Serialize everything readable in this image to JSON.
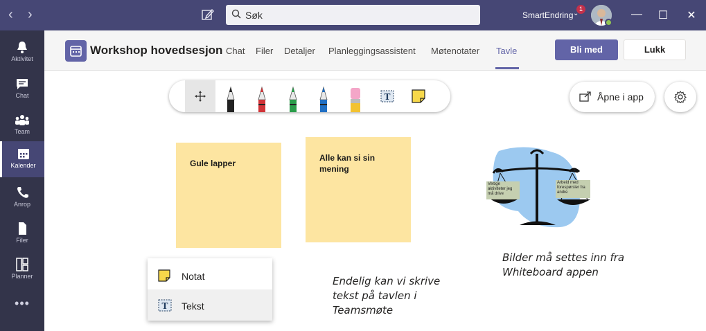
{
  "titlebar": {
    "search_placeholder": "Søk",
    "user_name": "SmartEndring",
    "notification_count": "1",
    "window_controls": [
      "minimize",
      "maximize",
      "close"
    ]
  },
  "rail": {
    "items": [
      {
        "label": "Aktivitet",
        "icon": "bell-icon"
      },
      {
        "label": "Chat",
        "icon": "chat-icon"
      },
      {
        "label": "Team",
        "icon": "team-icon"
      },
      {
        "label": "Kalender",
        "icon": "calendar-icon",
        "active": true
      },
      {
        "label": "Anrop",
        "icon": "phone-icon"
      },
      {
        "label": "Filer",
        "icon": "file-icon"
      },
      {
        "label": "Planner",
        "icon": "planner-icon"
      }
    ],
    "more": "•••"
  },
  "header": {
    "title": "Workshop hovedsesjon",
    "tabs": [
      "Chat",
      "Filer",
      "Detaljer",
      "Planleggingsassistent",
      "Møtenotater",
      "Tavle"
    ],
    "active_tab": "Tavle",
    "join_label": "Bli med",
    "close_label": "Lukk"
  },
  "whiteboard": {
    "open_in_app_label": "Åpne i app",
    "sticky_notes": [
      "Gule lapper",
      "Alle kan si sin mening"
    ],
    "handwritten": [
      "Endelig kan vi skrive tekst på tavlen i Teamsmøte",
      "Bilder må settes inn fra Whiteboard appen"
    ],
    "image_labels": [
      "Viktige aktiviteter jeg må drive",
      "Arbeid med forespørsler fra andre"
    ],
    "tools": [
      "move-icon",
      "black-pen-icon",
      "red-pen-icon",
      "green-pen-icon",
      "blue-pen-icon",
      "eraser-icon",
      "text-icon",
      "note-icon"
    ],
    "popup_items": [
      "Notat",
      "Tekst"
    ],
    "colors": {
      "accent": "#6264a7",
      "sticky": "#fde5a1",
      "titlebar": "#464775",
      "rail": "#33344a"
    }
  }
}
